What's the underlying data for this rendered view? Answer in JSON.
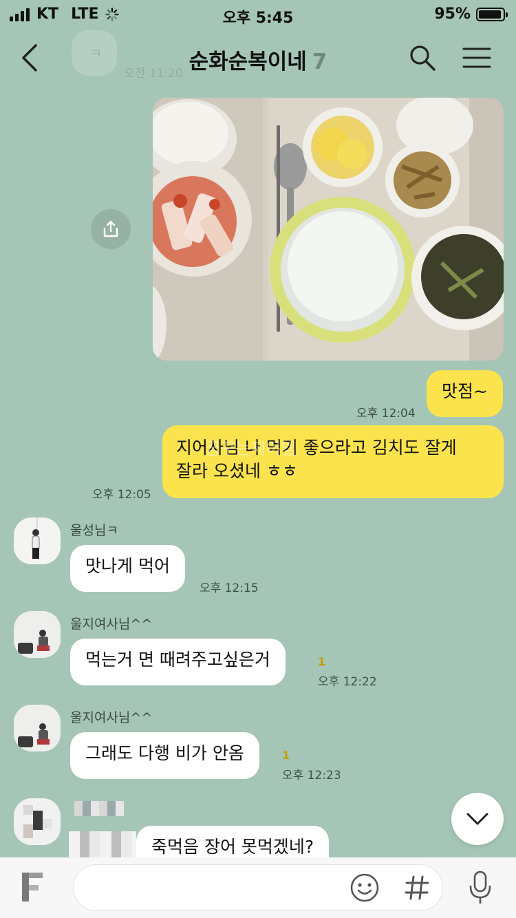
{
  "status_bar": {
    "carrier": "KT",
    "network": "LTE",
    "time": "오후 5:45",
    "battery": "95%",
    "battery_level": 0.95
  },
  "header": {
    "title": "순화순복이네",
    "member_count": "7"
  },
  "ghost_message": {
    "text": "ㅋ",
    "time": "오전 11:20"
  },
  "messages": {
    "m1_text": "맛점~",
    "m1_time": "오후 12:04",
    "m2_line1": "지어사님 나 먹기 좋으라고 김치도 잘게",
    "m2_line2": "잘라 오셨네 ㅎㅎ",
    "m2_time": "오후 12:05",
    "m3_sender": "울성님ㅋ",
    "m3_text": "맛나게 먹어",
    "m3_time": "오후 12:15",
    "m4_sender": "울지여사님^^",
    "m4_text": "먹는거 면  때려주고싶은거",
    "m4_unread": "1",
    "m4_time": "오후 12:22",
    "m5_sender": "울지여사님^^",
    "m5_text": "그래도 다행 비가 안옴",
    "m5_unread": "1",
    "m5_time": "오후 12:23",
    "m6_text": "죽먹음 장어 못먹겠네?"
  },
  "watermark": "꿈꾸는제이엠",
  "colors": {
    "background": "#a5c5b6",
    "my_bubble": "#fae34c",
    "other_bubble": "#ffffff"
  }
}
